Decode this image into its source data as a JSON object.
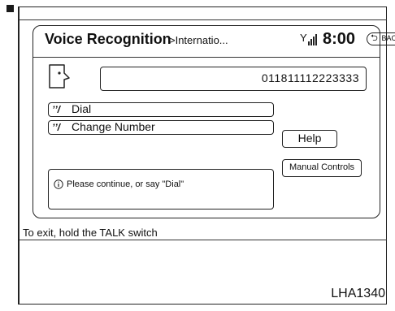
{
  "header": {
    "title": "Voice Recognition",
    "breadcrumb": ">Internatio...",
    "signal_icon": "signal-antenna-icon",
    "clock": "8:00",
    "back_label": "BACK",
    "back_icon": "return-arrow-icon"
  },
  "dial_entry": {
    "speaker_icon": "speaking-head-icon",
    "number": "011811112223333"
  },
  "commands": [
    {
      "label": "Dial",
      "icon": "voice-command-icon"
    },
    {
      "label": "Change Number",
      "icon": "voice-command-icon"
    }
  ],
  "side_buttons": {
    "help_label": "Help",
    "manual_label": "Manual Controls"
  },
  "message": {
    "icon": "info-icon",
    "text": "Please continue, or say \"Dial\""
  },
  "footer": {
    "text": "To exit, hold the TALK switch"
  },
  "figure": {
    "code": "LHA1340"
  }
}
